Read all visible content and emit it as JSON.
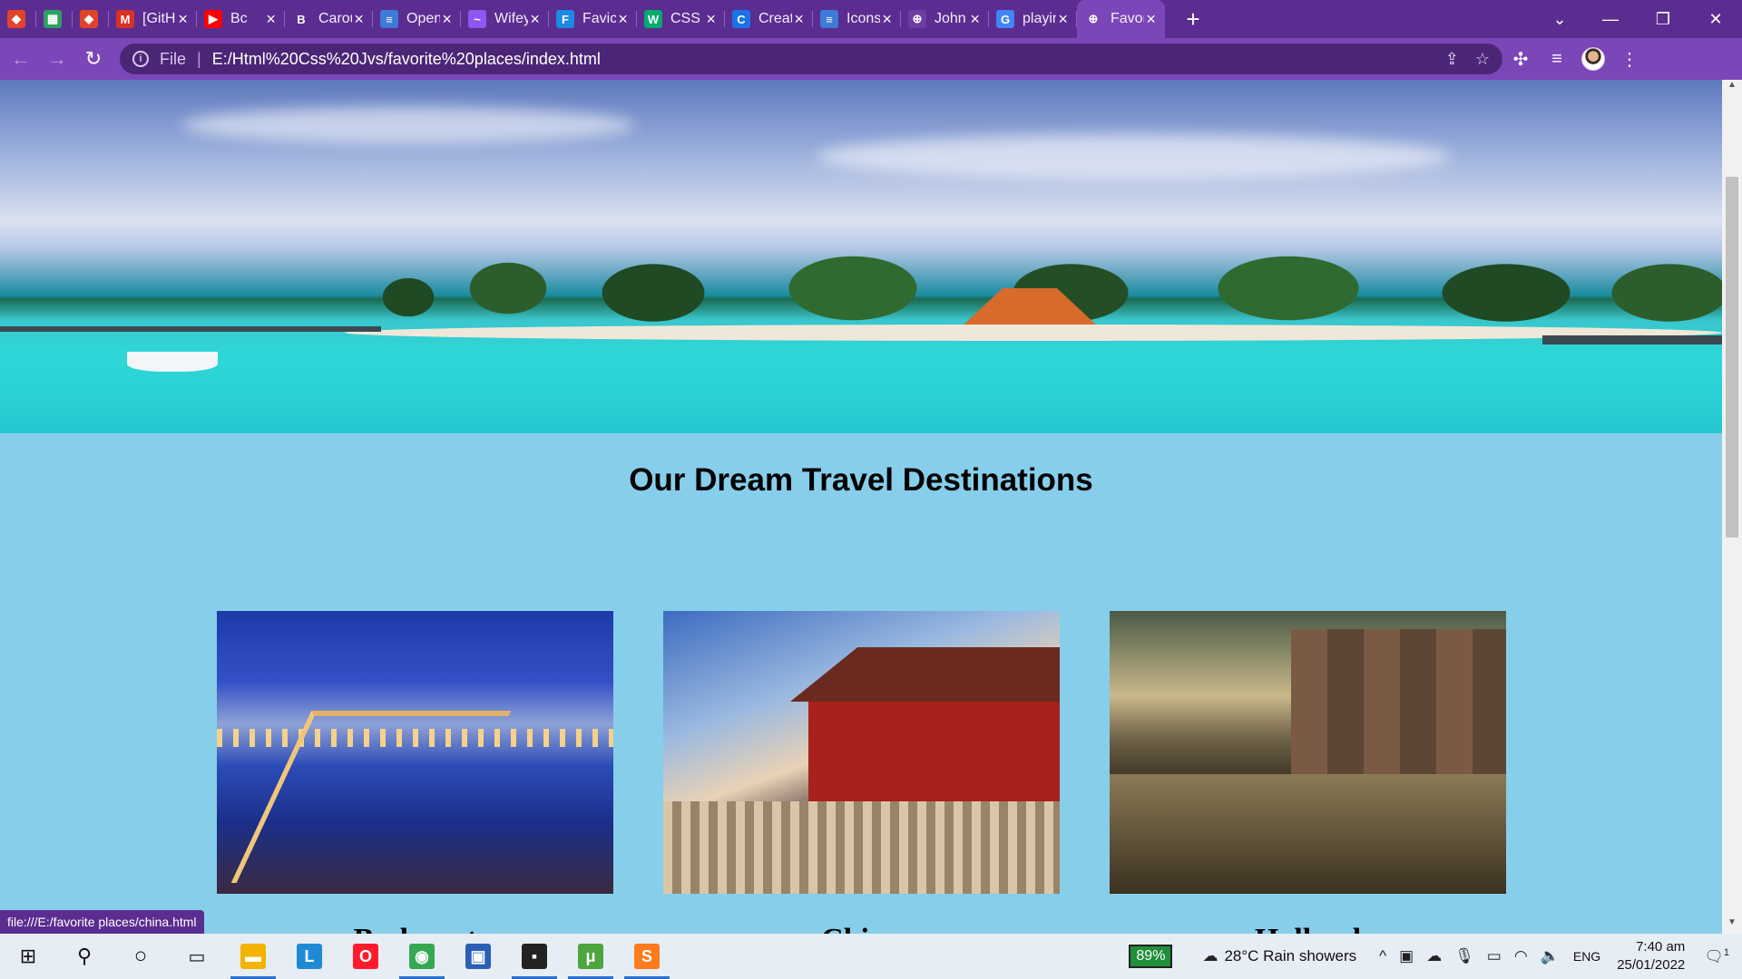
{
  "browser": {
    "tabs": [
      {
        "title": "",
        "icon": "gitlab-icon",
        "color": "#e24329",
        "glyph": "◆"
      },
      {
        "title": "",
        "icon": "sheets-icon",
        "color": "#2e9f62",
        "glyph": "▦"
      },
      {
        "title": "",
        "icon": "gitlab-icon",
        "color": "#e24329",
        "glyph": "◆"
      },
      {
        "title": "[GitHu",
        "icon": "gmail-icon",
        "color": "#d93025",
        "glyph": "M"
      },
      {
        "title": "Bc",
        "icon": "youtube-icon",
        "color": "#ff0000",
        "glyph": "▶"
      },
      {
        "title": "Carou",
        "icon": "bootstrap-icon",
        "color": "#5b2d91",
        "glyph": "B"
      },
      {
        "title": "Open",
        "icon": "multicolor-icon",
        "color": "#3d7bd9",
        "glyph": "≡"
      },
      {
        "title": "Wifey",
        "icon": "messenger-icon",
        "color": "#8e57f2",
        "glyph": "~"
      },
      {
        "title": "Favicc",
        "icon": "favicon-generator-icon",
        "color": "#1e88e5",
        "glyph": "F"
      },
      {
        "title": "CSS C",
        "icon": "w3schools-icon",
        "color": "#04aa6d",
        "glyph": "W"
      },
      {
        "title": "Creat",
        "icon": "google-circle-icon",
        "color": "#1a73e8",
        "glyph": "C"
      },
      {
        "title": "Icons",
        "icon": "multicolor-icon",
        "color": "#3d7bd9",
        "glyph": "≡"
      },
      {
        "title": "John",
        "icon": "globe-icon",
        "color": "#6a3ea1",
        "glyph": "⊕"
      },
      {
        "title": "playin",
        "icon": "google-icon",
        "color": "#4285f4",
        "glyph": "G"
      },
      {
        "title": "Favori",
        "icon": "globe-icon",
        "color": "#7b46b8",
        "glyph": "⊕",
        "active": true
      }
    ],
    "new_tab": "+",
    "address": {
      "scheme_label": "File",
      "url": "E:/Html%20Css%20Jvs/favorite%20places/index.html"
    },
    "status_url": "file:///E:/favorite places/china.html"
  },
  "page": {
    "heading": "Our Dream Travel Destinations",
    "destinations": [
      {
        "name": "Budapest"
      },
      {
        "name": "China"
      },
      {
        "name": "Holland"
      }
    ]
  },
  "taskbar": {
    "battery": "89%",
    "weather": "28°C  Rain showers",
    "language": "ENG",
    "time": "7:40 am",
    "date": "25/01/2022",
    "notification_count": "1",
    "apps": [
      {
        "name": "file-explorer",
        "color": "#f2b400",
        "glyph": "▬",
        "open": true
      },
      {
        "name": "lingo-app",
        "color": "#1e8ad6",
        "glyph": "L",
        "open": false
      },
      {
        "name": "opera",
        "color": "#ff1b2d",
        "glyph": "O",
        "open": false
      },
      {
        "name": "chrome",
        "color": "#34a853",
        "glyph": "◉",
        "open": true
      },
      {
        "name": "remote-desktop",
        "color": "#2b5fb8",
        "glyph": "▣",
        "open": false
      },
      {
        "name": "sticky-notes",
        "color": "#222222",
        "glyph": "▪",
        "open": true
      },
      {
        "name": "utorrent",
        "color": "#4ca53d",
        "glyph": "μ",
        "open": true
      },
      {
        "name": "sublime-text",
        "color": "#ff7b1c",
        "glyph": "S",
        "open": true
      }
    ]
  }
}
